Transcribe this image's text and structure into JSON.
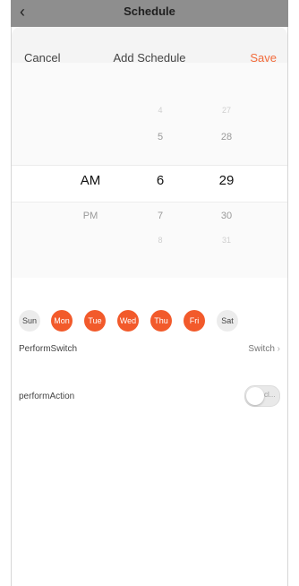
{
  "topbar": {
    "back_icon": "chevron-left-icon",
    "title": "Schedule"
  },
  "header": {
    "cancel": "Cancel",
    "title": "Add Schedule",
    "save": "Save"
  },
  "picker": {
    "period": {
      "selected": "AM",
      "next": "PM"
    },
    "hour": {
      "prev_far": "4",
      "prev": "5",
      "selected": "6",
      "next": "7",
      "next_far": "8"
    },
    "minute": {
      "prev_far": "27",
      "prev": "28",
      "selected": "29",
      "next": "30",
      "next_far": "31"
    }
  },
  "days": [
    {
      "label": "Sun",
      "selected": false
    },
    {
      "label": "Mon",
      "selected": true
    },
    {
      "label": "Tue",
      "selected": true
    },
    {
      "label": "Wed",
      "selected": true
    },
    {
      "label": "Thu",
      "selected": true
    },
    {
      "label": "Fri",
      "selected": true
    },
    {
      "label": "Sat",
      "selected": false
    }
  ],
  "perform_switch": {
    "label": "PerformSwitch",
    "value": "Switch",
    "chevron_icon": "chevron-right-icon"
  },
  "perform_action": {
    "label": "performAction",
    "toggle_text": "cl...",
    "on": false
  },
  "colors": {
    "accent": "#f25a2b",
    "save": "#f26a3a"
  }
}
